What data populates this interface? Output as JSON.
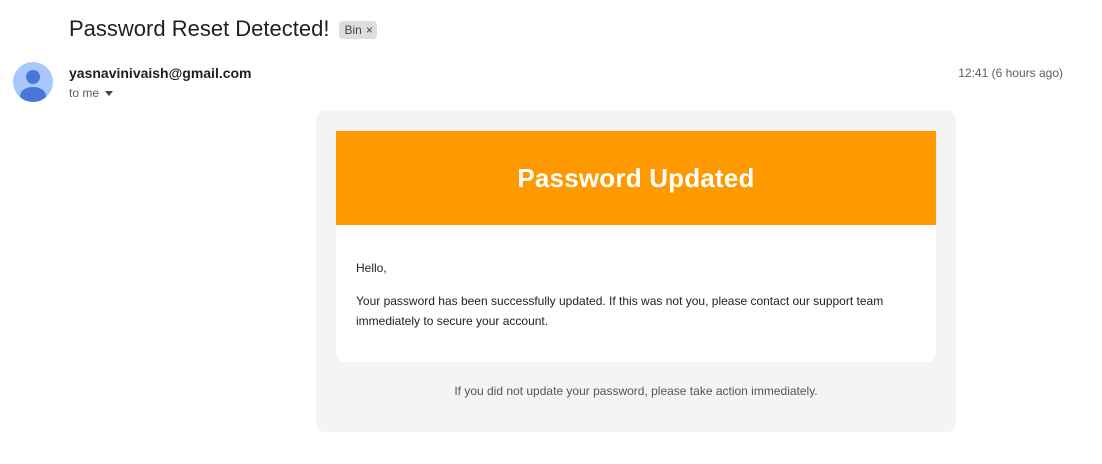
{
  "email": {
    "subject": "Password Reset Detected!",
    "label": "Bin",
    "label_close": "×",
    "sender": "yasnavinivaish@gmail.com",
    "recipient": "to me",
    "timestamp": "12:41 (6 hours ago)"
  },
  "body": {
    "banner_title": "Password Updated",
    "banner_color": "#ff9900",
    "greeting": "Hello,",
    "message": "Your password has been successfully updated. If this was not you, please contact our support team immediately to secure your account.",
    "footer": "If you did not update your password, please take action immediately."
  },
  "icons": {
    "avatar": "person-avatar-icon",
    "recipient_details": "chevron-down-icon",
    "label_remove": "close-icon"
  }
}
